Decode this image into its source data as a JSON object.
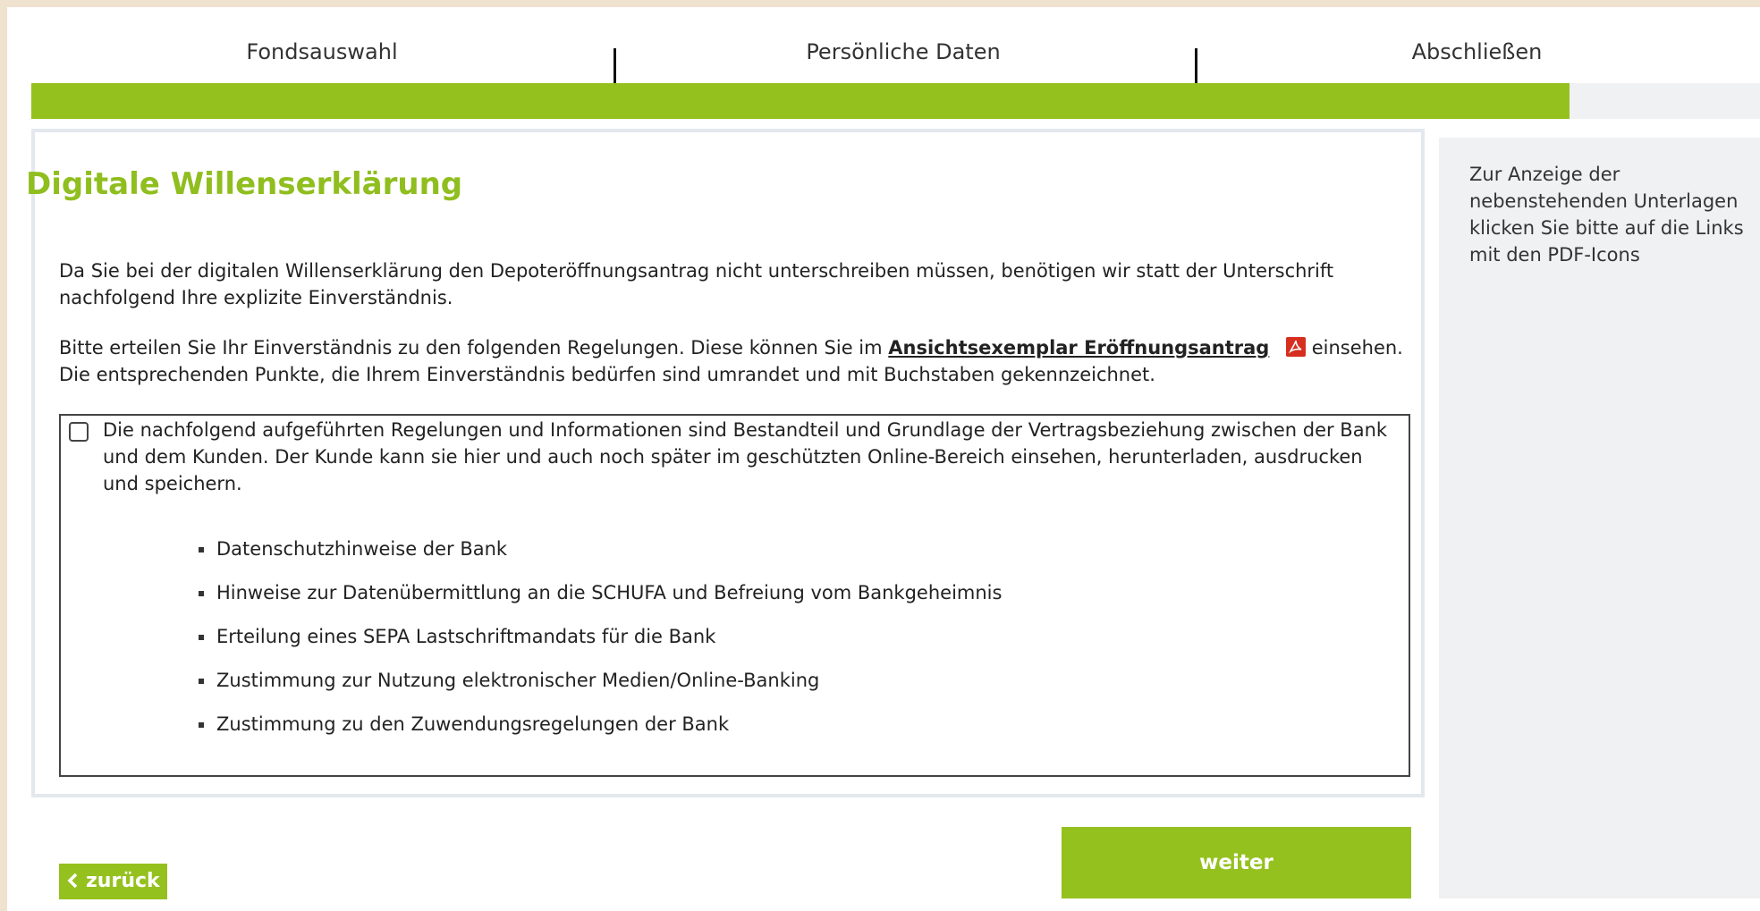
{
  "stepper": {
    "steps": [
      "Fondsauswahl",
      "Persönliche Daten",
      "Abschließen"
    ],
    "progress_percent": 89,
    "progress_color": "#95c11f"
  },
  "main": {
    "title": "Digitale Willenserklärung",
    "intro": "Da Sie bei der digitalen Willenserklärung den Depoteröffnungsantrag nicht unterschreiben müssen, benötigen wir statt der Unterschrift nachfolgend Ihre explizite Einverständnis.",
    "instruction_before": "Bitte erteilen Sie Ihr Einverständnis zu den folgenden Regelungen. Diese können Sie im",
    "document_link": "Ansichtsexemplar Eröffnungsantrag",
    "instruction_after": "einsehen. Die entsprechenden Punkte, die Ihrem Einverständnis bedürfen sind umrandet und mit Buchstaben gekennzeichnet.",
    "consent": {
      "checked": false,
      "text": "Die nachfolgend aufgeführten Regelungen und Informationen sind Bestandteil und Grundlage der Vertragsbeziehung zwischen der Bank und dem Kunden. Der Kunde kann sie hier und auch noch später im geschützten Online-Bereich einsehen, herunterladen, ausdrucken und speichern.",
      "items": [
        "Datenschutzhinweise der Bank",
        "Hinweise zur Datenübermittlung an die SCHUFA und Befreiung vom Bankgeheimnis",
        "Erteilung eines SEPA Lastschriftmandats für die Bank",
        "Zustimmung zur Nutzung elektronischer Medien/Online-Banking",
        "Zustimmung zu den Zuwendungsregelungen der Bank"
      ]
    }
  },
  "buttons": {
    "back_label": "zurück",
    "next_label": "weiter"
  },
  "sidebar": {
    "text": "Zur Anzeige der nebenstehenden Unterlagen klicken Sie bitte auf die Links mit den PDF-Icons"
  },
  "icons": {
    "pdf": "pdf-icon",
    "back": "chevron-left-icon"
  },
  "colors": {
    "accent": "#95c11f",
    "title": "#8fbe1e",
    "pdf": "#d62e1f",
    "background": "#efe2cf",
    "sidebar": "#f0f1f3"
  }
}
